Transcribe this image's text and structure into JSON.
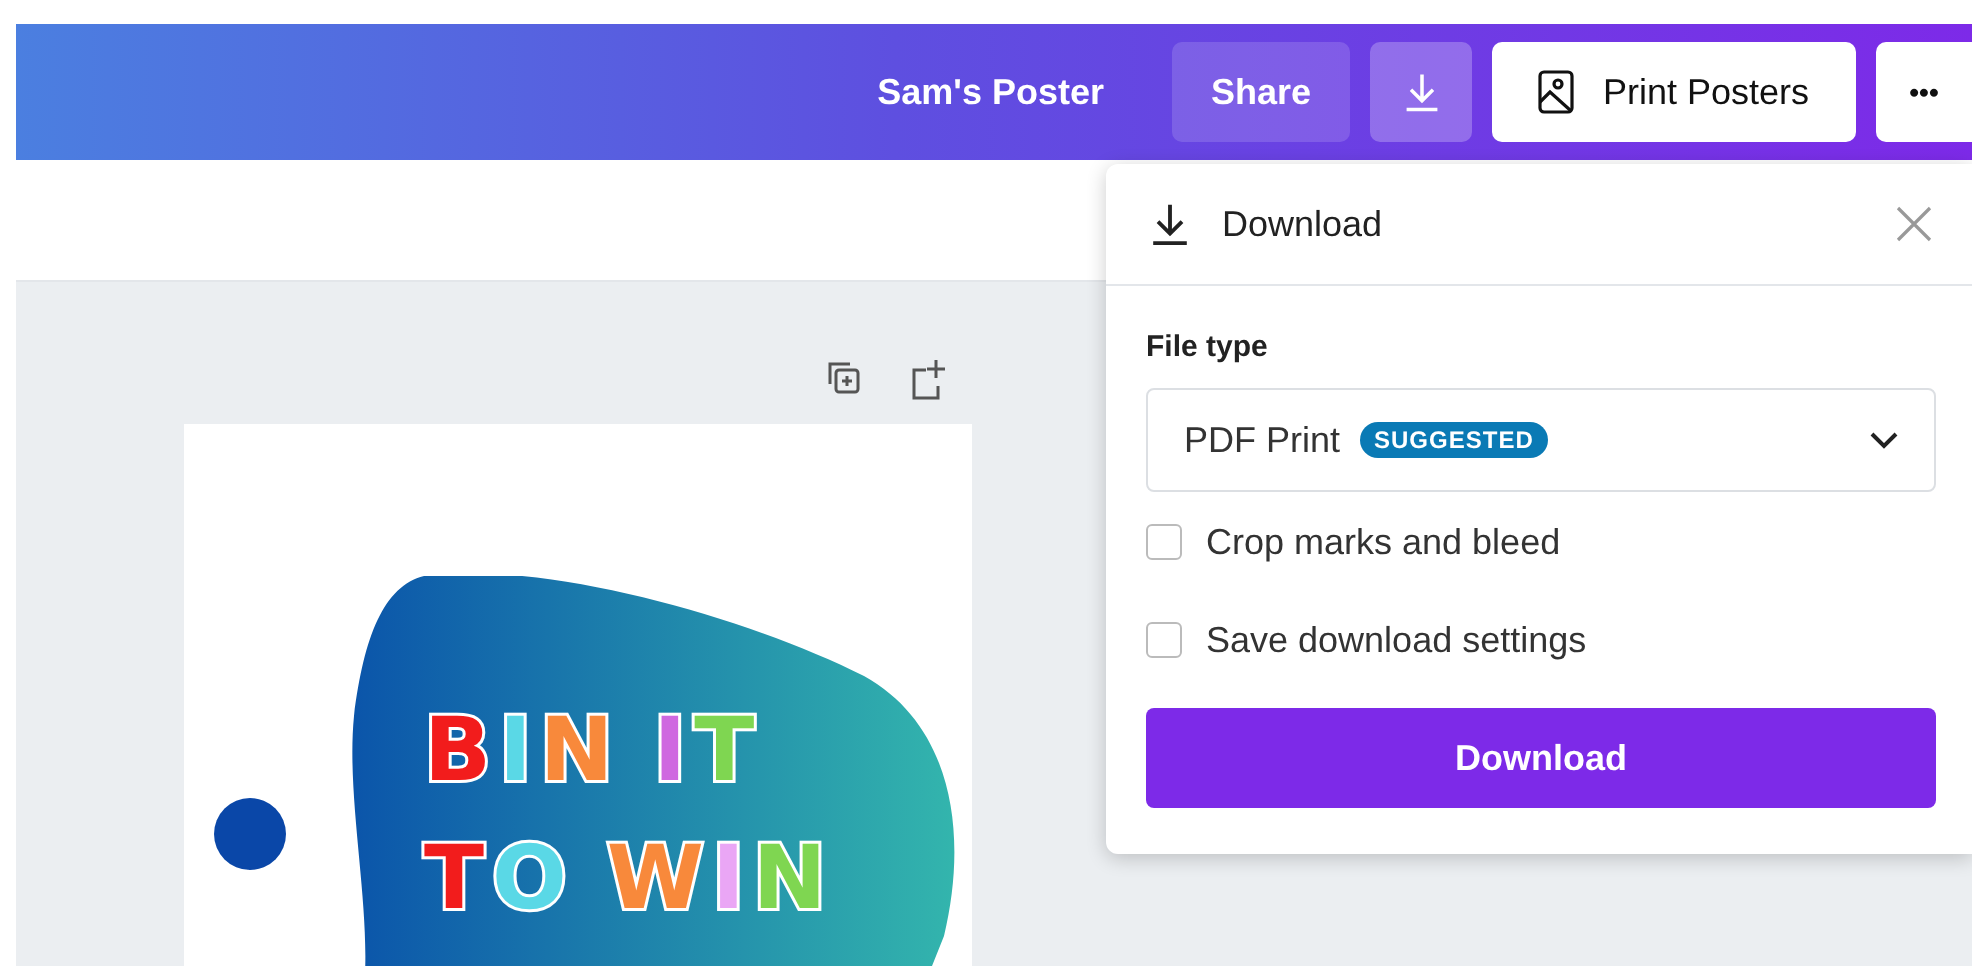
{
  "topbar": {
    "title": "Sam's Poster",
    "share": "Share",
    "print": "Print Posters",
    "more": "•••"
  },
  "poster": {
    "lines": [
      {
        "words": [
          {
            "letters": [
              {
                "char": "B",
                "color": "#f21c1c"
              },
              {
                "char": "I",
                "color": "#5ad8e6"
              },
              {
                "char": "N",
                "color": "#f8893b"
              }
            ]
          },
          {
            "letters": [
              {
                "char": "I",
                "color": "#cf68e0"
              },
              {
                "char": "T",
                "color": "#7fd651"
              }
            ]
          }
        ]
      },
      {
        "words": [
          {
            "letters": [
              {
                "char": "T",
                "color": "#f21c1c"
              },
              {
                "char": "O",
                "color": "#5ad8e6"
              }
            ]
          },
          {
            "letters": [
              {
                "char": "W",
                "color": "#f8893b"
              },
              {
                "char": "I",
                "color": "#eaa6f5"
              },
              {
                "char": "N",
                "color": "#7fd651"
              }
            ]
          }
        ]
      }
    ]
  },
  "download_panel": {
    "title": "Download",
    "file_type_label": "File type",
    "file_type": {
      "value": "PDF Print",
      "badge": "SUGGESTED"
    },
    "options": [
      {
        "label": "Crop marks and bleed",
        "checked": false
      },
      {
        "label": "Save download settings",
        "checked": false
      }
    ],
    "button": "Download"
  }
}
